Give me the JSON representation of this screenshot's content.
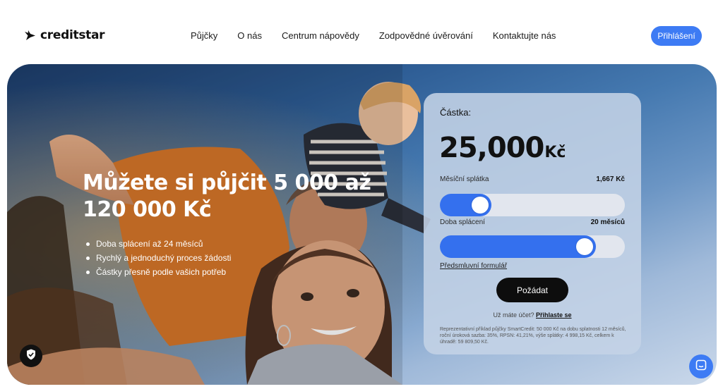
{
  "brand": {
    "name": "creditstar",
    "accent": "#3d7bf4"
  },
  "nav": {
    "items": [
      {
        "label": "Půjčky"
      },
      {
        "label": "O nás"
      },
      {
        "label": "Centrum nápovědy"
      },
      {
        "label": "Zodpovědné úvěrování"
      },
      {
        "label": "Kontaktujte nás"
      }
    ],
    "login_label": "Přihlášení"
  },
  "hero": {
    "title": "Můžete si půjčit 5 000 až 120 000 Kč",
    "bullets": [
      "Doba splácení až 24 měsíců",
      "Rychlý a jednoduchý proces žádosti",
      "Částky přesně podle vašich potřeb"
    ]
  },
  "calculator": {
    "amount_label": "Částka:",
    "amount_value": "25,000",
    "amount_currency": "Kč",
    "monthly_label": "Měsíční splátka",
    "monthly_value": "1,667 Kč",
    "amount_slider_fraction": 0.18,
    "term_label": "Doba splácení",
    "term_value": "20 měsíců",
    "term_slider_fraction": 0.82,
    "form_link": "Předsmluvní formulář",
    "submit_label": "Požádat",
    "account_prompt": "Už máte účet?",
    "account_link": "Přihlaste se",
    "representative_example": "Reprezentativní příklad půjčky SmartCredit: 50 000 Kč na dobu splatnosti 12 měsíců, roční úroková sazba: 35%, RPSN: 41,21%, výše splátky: 4 998,15 Kč, celkem k úhradě: 59 809,50 Kč."
  },
  "icons": {
    "logo": "star-logo-icon",
    "privacy": "shield-check-icon",
    "chat": "chat-icon"
  }
}
